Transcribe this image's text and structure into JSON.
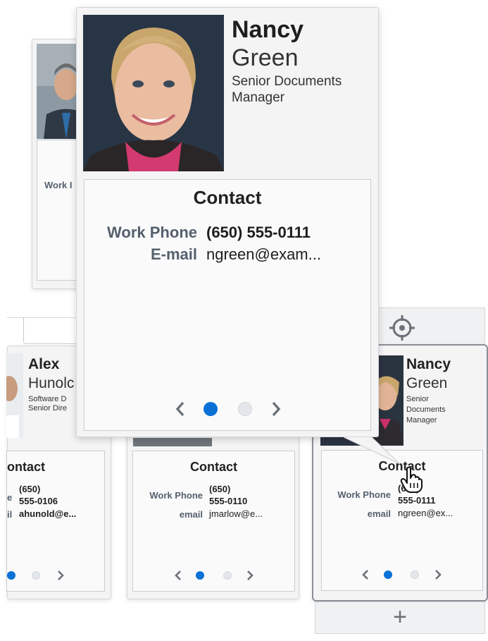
{
  "small_left_card": {
    "label_fragment": "Work I"
  },
  "cards": {
    "alex": {
      "first_name": "Alex",
      "last_name": "Hunolc",
      "title_line1": "Software D",
      "title_line2": "Senior Dire",
      "contact_heading": "ontact",
      "phone_label_fragment": "e",
      "phone_line1": "(650)",
      "phone_line2": "555-0106",
      "email_label_fragment": "il",
      "email_value": "ahunold@e..."
    },
    "jmarlow": {
      "contact_heading": "Contact",
      "phone_label": "Work Phone",
      "phone_line1": "(650)",
      "phone_line2": "555-0110",
      "email_label": "email",
      "email_value": "jmarlow@e..."
    },
    "nancy_small": {
      "first_name": "Nancy",
      "last_name": "Green",
      "title_line1": "Senior",
      "title_line2": "Documents",
      "title_line3": "Manager",
      "contact_heading": "Contact",
      "phone_label": "Work Phone",
      "phone_line1": "(650)",
      "phone_line2": "555-0111",
      "email_label": "email",
      "email_value": "ngreen@ex..."
    }
  },
  "popup": {
    "first_name": "Nancy",
    "last_name": "Green",
    "title_line1": "Senior Documents",
    "title_line2": "Manager",
    "contact_heading": "Contact",
    "phone_label": "Work Phone",
    "phone_value": "(650) 555-0111",
    "email_label": "E-mail",
    "email_value": "ngreen@exam..."
  },
  "toolbar": {
    "add_label": "+"
  },
  "pagination": {
    "active_page": 1,
    "page_count": 2
  },
  "colors": {
    "accent": "#0a72d6",
    "label": "#55606e"
  },
  "icons": [
    "crosshair-icon",
    "chevron-left-icon",
    "chevron-right-icon",
    "hand-cursor-icon",
    "plus-icon"
  ]
}
